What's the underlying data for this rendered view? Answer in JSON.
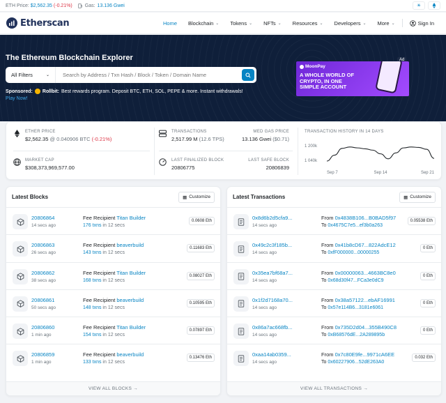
{
  "topbar": {
    "eth_price_label": "ETH Price:",
    "eth_price_value": "$2,562.35",
    "eth_price_change": "(-0.21%)",
    "gas_label": "Gas:",
    "gas_value": "13.136 Gwei"
  },
  "nav": {
    "logo": "Etherscan",
    "items": [
      "Home",
      "Blockchain",
      "Tokens",
      "NFTs",
      "Resources",
      "Developers",
      "More"
    ],
    "sign_in": "Sign In"
  },
  "hero": {
    "title": "The Ethereum Blockchain Explorer",
    "filter": "All Filters",
    "search_placeholder": "Search by Address / Txn Hash / Block / Token / Domain Name",
    "sponsored_label": "Sponsored:",
    "sponsor_name": "Rollbit:",
    "sponsor_text": "Best rewards program. Deposit BTC, ETH, SOL, PEPE & more. Instant withdrawals!",
    "play_now": "Play Now!",
    "ad_badge": "Ad",
    "ad_brand": "MoonPay",
    "ad_text": "A whole world of crypto, in one simple account"
  },
  "stats": {
    "ether_price_label": "ETHER PRICE",
    "ether_price": "$2,562.35",
    "ether_btc": "@ 0.040906 BTC",
    "ether_change": "(-0.21%)",
    "market_cap_label": "MARKET CAP",
    "market_cap": "$308,373,969,577.00",
    "transactions_label": "TRANSACTIONS",
    "transactions": "2,517.99 M",
    "tps": "(12.6 TPS)",
    "med_gas_label": "MED GAS PRICE",
    "med_gas": "13.136 Gwei",
    "med_gas_usd": "($0.71)",
    "finalized_label": "LAST FINALIZED BLOCK",
    "finalized": "20806775",
    "safe_label": "LAST SAFE BLOCK",
    "safe": "20806839",
    "history_label": "TRANSACTION HISTORY IN 14 DAYS"
  },
  "chart_data": {
    "type": "line",
    "title": "TRANSACTION HISTORY IN 14 DAYS",
    "y_tick_labels": [
      "1 200k",
      "1 040k"
    ],
    "y_ticks": [
      1200,
      1040
    ],
    "x_tick_labels": [
      "Sep 7",
      "Sep 14",
      "Sep 21"
    ],
    "ylim": [
      1000,
      1260
    ],
    "x": [
      "Sep 7",
      "Sep 8",
      "Sep 9",
      "Sep 10",
      "Sep 11",
      "Sep 12",
      "Sep 13",
      "Sep 14",
      "Sep 15",
      "Sep 16",
      "Sep 17",
      "Sep 18",
      "Sep 19",
      "Sep 20",
      "Sep 21"
    ],
    "values": [
      1030,
      1095,
      1170,
      1185,
      1175,
      1165,
      1150,
      1110,
      1055,
      1120,
      1175,
      1185,
      1180,
      1160,
      1060
    ]
  },
  "blocks": {
    "title": "Latest Blocks",
    "customize": "Customize",
    "footer": "VIEW ALL BLOCKS →",
    "rows": [
      {
        "block": "20806864",
        "age": "14 secs ago",
        "recipient_label": "Fee Recipient",
        "recipient": "Titan Builder",
        "txns": "176 txns",
        "in": "in 12 secs",
        "reward": "0.0608 Eth"
      },
      {
        "block": "20806863",
        "age": "26 secs ago",
        "recipient_label": "Fee Recipient",
        "recipient": "beaverbuild",
        "txns": "143 txns",
        "in": "in 12 secs",
        "reward": "0.11683 Eth"
      },
      {
        "block": "20806862",
        "age": "38 secs ago",
        "recipient_label": "Fee Recipient",
        "recipient": "Titan Builder",
        "txns": "168 txns",
        "in": "in 12 secs",
        "reward": "0.08027 Eth"
      },
      {
        "block": "20806861",
        "age": "50 secs ago",
        "recipient_label": "Fee Recipient",
        "recipient": "beaverbuild",
        "txns": "148 txns",
        "in": "in 12 secs",
        "reward": "0.10595 Eth"
      },
      {
        "block": "20806860",
        "age": "1 min ago",
        "recipient_label": "Fee Recipient",
        "recipient": "Titan Builder",
        "txns": "154 txns",
        "in": "in 12 secs",
        "reward": "0.07897 Eth"
      },
      {
        "block": "20806859",
        "age": "1 min ago",
        "recipient_label": "Fee Recipient",
        "recipient": "beaverbuild",
        "txns": "133 txns",
        "in": "in 12 secs",
        "reward": "0.13476 Eth"
      }
    ]
  },
  "transactions": {
    "title": "Latest Transactions",
    "customize": "Customize",
    "footer": "VIEW ALL TRANSACTIONS →",
    "rows": [
      {
        "hash": "0x8d6b2d5cfa9...",
        "age": "14 secs ago",
        "from_label": "From",
        "from": "0x4838B106...B0BAD5f97",
        "to_label": "To",
        "to": "0x4675C7e5...ef3b0a263",
        "value": "0.05538 Eth"
      },
      {
        "hash": "0x49c2c3f185b...",
        "age": "14 secs ago",
        "from_label": "From",
        "from": "0x41b8cD67...822AdcE12",
        "to_label": "To",
        "to": "0xfF000000...00000255",
        "value": "0 Eth"
      },
      {
        "hash": "0x35ea7bf68a7...",
        "age": "14 secs ago",
        "from_label": "From",
        "from": "0x00000063...4663BC8e0",
        "to_label": "To",
        "to": "0x68d30f47...FCa3e0dC9",
        "value": "0 Eth"
      },
      {
        "hash": "0x1f2d7168a70...",
        "age": "14 secs ago",
        "from_label": "From",
        "from": "0x38a57122...ebAF16991",
        "to_label": "To",
        "to": "0x57e114B6...3181e6061",
        "value": "0 Eth"
      },
      {
        "hash": "0x86a7ac668fb...",
        "age": "14 secs ago",
        "from_label": "From",
        "from": "0x735D2d04...355B490C8",
        "to_label": "To",
        "to": "0xB68576dE...2A289895b",
        "value": "0 Eth"
      },
      {
        "hash": "0xaa14ab0359...",
        "age": "14 secs ago",
        "from_label": "From",
        "from": "0x7c80E9fe...9971cA6EE",
        "to_label": "To",
        "to": "0x60227906...52dE263A0",
        "value": "0.032 Eth"
      }
    ]
  },
  "colors": {
    "accent": "#0784c3",
    "hero_bg": "#0f1f3a",
    "negative": "#dc3545"
  }
}
